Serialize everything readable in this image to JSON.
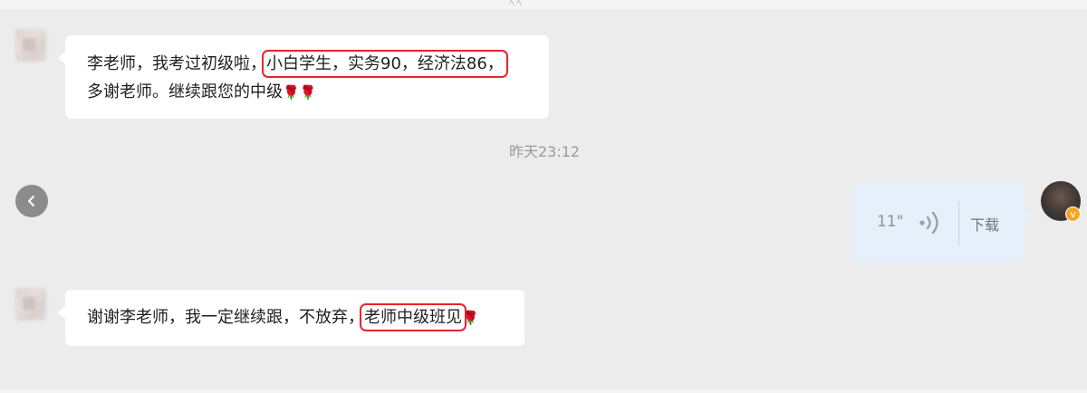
{
  "chat": {
    "messages": [
      {
        "sender": "student",
        "line1_prefix": "李老师，我考过初级啦，",
        "line1_highlight": "小白学生，实务90，经济法86，",
        "line2": "多谢老师。继续跟您的中级",
        "emoji": "🌹🌹"
      },
      {
        "sender": "student",
        "prefix": "谢谢李老师，我一定继续跟，不放弃，",
        "highlight": "老师中级班见",
        "emoji": "🌹"
      }
    ],
    "timestamp": "昨天23:12",
    "voice": {
      "duration": "11\"",
      "download_label": "下载"
    },
    "top_glyph": "ﾍﾍ",
    "badge_glyph": "v",
    "colors": {
      "highlight_border": "#e8232f",
      "voice_bubble": "#e6f0fb",
      "badge": "#f5a623"
    }
  }
}
